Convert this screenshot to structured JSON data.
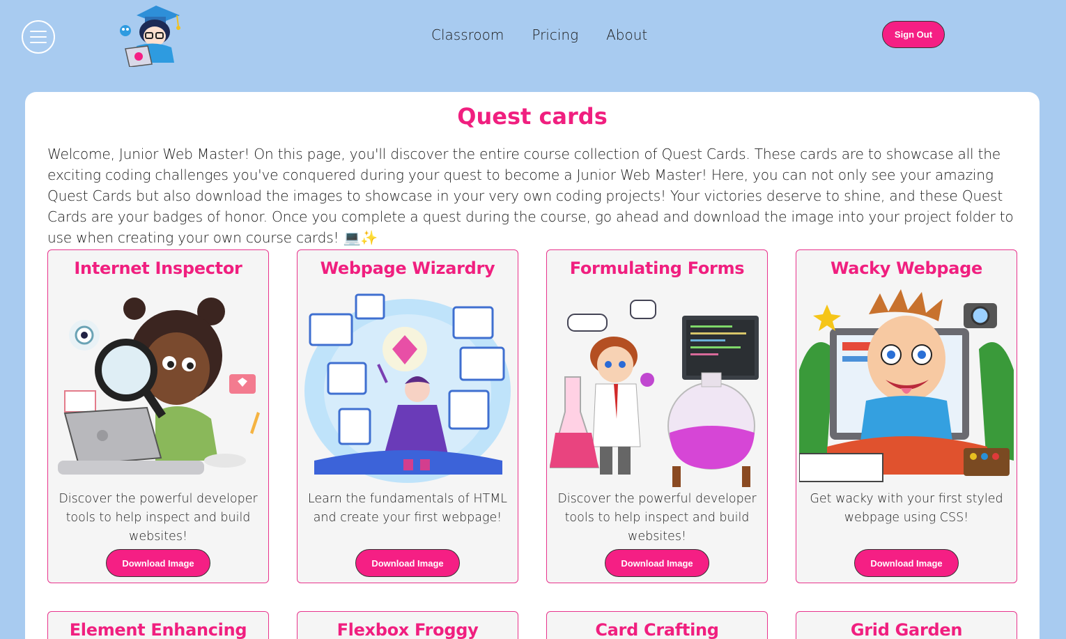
{
  "header": {
    "nav": [
      "Classroom",
      "Pricing",
      "About"
    ],
    "sign_out": "Sign Out"
  },
  "page": {
    "title": "Quest cards",
    "intro": "Welcome, Junior Web Master! On this page, you'll discover the entire course collection of Quest Cards. These cards are to showcase all the exciting coding challenges you've conquered during your quest to become a Junior Web Master! Here, you can not only see your amazing Quest Cards but also download the images to showcase in your very own coding projects! Your victories deserve to shine, and these Quest Cards are your badges of honor. Once you complete a quest during the course, go ahead and download the image into your project folder to use when creating your own course cards! 💻✨"
  },
  "cards": [
    {
      "title": "Internet Inspector",
      "desc": "Discover the powerful developer tools to help inspect and build websites!",
      "button": "Download Image"
    },
    {
      "title": "Webpage Wizardry",
      "desc": "Learn the fundamentals of HTML and create your first webpage!",
      "button": "Download Image"
    },
    {
      "title": "Formulating Forms",
      "desc": "Discover the powerful developer tools to help inspect and build websites!",
      "button": "Download Image"
    },
    {
      "title": "Wacky Webpage",
      "desc": "Get wacky with your first styled webpage using CSS!",
      "button": "Download Image"
    },
    {
      "title": "Element Enhancing"
    },
    {
      "title": "Flexbox Froggy"
    },
    {
      "title": "Card Crafting"
    },
    {
      "title": "Grid Garden"
    }
  ],
  "colors": {
    "accent": "#f51f84",
    "background": "#a8cbf0",
    "panel": "#ffffff"
  }
}
